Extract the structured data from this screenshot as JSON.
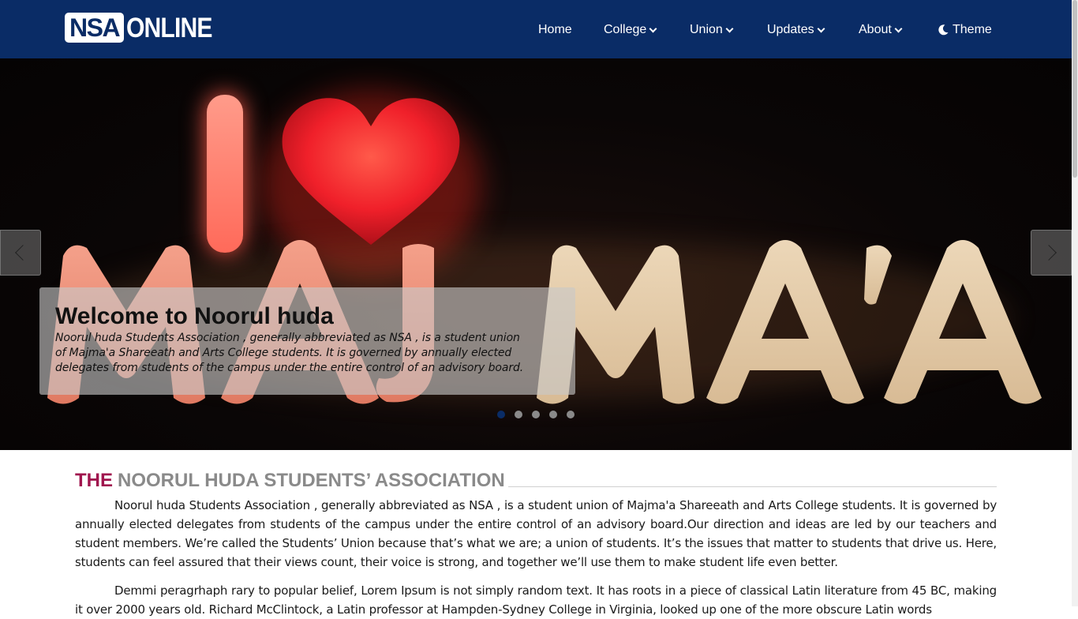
{
  "brand": {
    "logo_box": "NSA",
    "logo_text": "ONLINE"
  },
  "nav": {
    "home": "Home",
    "college": "College",
    "union": "Union",
    "updates": "Updates",
    "about": "About",
    "theme": "Theme"
  },
  "hero": {
    "image_alt": "I ♥ MAJMA'A",
    "caption_title": "Welcome to Noorul huda",
    "caption_line1": "Noorul huda Students Association , generally abbreviated as NSA , is a student union",
    "caption_line2": "of Majma'a Shareeath and Arts College students. It is governed by annually elected",
    "caption_line3": "delegates from students of the campus under the entire control of an advisory board.",
    "slide_count": 5,
    "active_slide": 1
  },
  "section": {
    "title_accent": "THE",
    "title_rest": "NOORUL HUDA STUDENTS’ ASSOCIATION",
    "paragraph1": "Noorul huda Students Association , generally abbreviated as NSA , is a student union of Majma'a Shareeath and Arts College students. It is governed by annually elected delegates from students of the campus under the entire control of an advisory board.Our direction and ideas are led by our teachers and student members. We’re called the Students’ Union because that’s what we are; a union of students. It’s the issues that matter to students that drive us. Here, students can feel assured that their views count, their voice is strong, and together we’ll use them to make student life even better.",
    "paragraph2": "Demmi peragrhaph rary to popular belief, Lorem Ipsum is not simply random text. It has roots in a piece of classical Latin literature from 45 BC, making it over 2000 years old. Richard McClintock, a Latin professor at Hampden-Sydney College in Virginia, looked up one of the more obscure Latin words"
  },
  "colors": {
    "navbar": "#0a2c66",
    "accent": "#a0154e",
    "title_gray": "#8a8a8a"
  }
}
